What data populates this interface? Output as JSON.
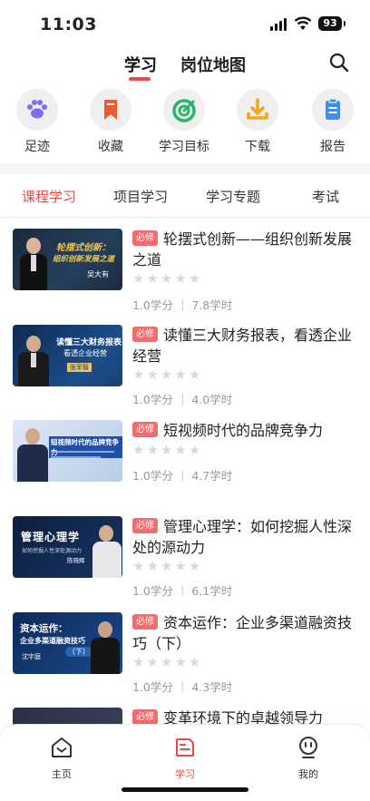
{
  "status": {
    "time": "11:03",
    "battery": "93"
  },
  "header": {
    "tabs": [
      {
        "label": "学习"
      },
      {
        "label": "岗位地图"
      }
    ],
    "active_tab": 0
  },
  "quick_actions": [
    {
      "label": "足迹",
      "icon": "paw-icon"
    },
    {
      "label": "收藏",
      "icon": "bookmark-icon"
    },
    {
      "label": "学习目标",
      "icon": "target-icon"
    },
    {
      "label": "下载",
      "icon": "download-icon"
    },
    {
      "label": "报告",
      "icon": "clipboard-icon"
    }
  ],
  "sub_tabs": [
    {
      "label": "课程学习"
    },
    {
      "label": "项目学习"
    },
    {
      "label": "学习专题"
    },
    {
      "label": "考试"
    }
  ],
  "courses": [
    {
      "badge": "必修",
      "title": "轮摆式创新——组织创新发展之道",
      "stars": "★★★★★",
      "meta": "1.0学分 ｜ 7.8学时",
      "thumb_title": "轮摆式创新：",
      "thumb_sub": "组织创新发展之道",
      "thumb_name": "吴大有"
    },
    {
      "badge": "必修",
      "title": "读懂三大财务报表，看透企业经营",
      "stars": "★★★★★",
      "meta": "1.0学分 ｜ 4.0学时",
      "thumb_title": "读懂三大财务报表",
      "thumb_sub": "看透企业经营",
      "thumb_name": "张军智"
    },
    {
      "badge": "必修",
      "title": "短视频时代的品牌竞争力",
      "stars": "★★★★★",
      "meta": "1.0学分 ｜ 4.7学时",
      "thumb_title": "短视频时代的品牌竞争力",
      "thumb_sub": "",
      "thumb_name": ""
    },
    {
      "badge": "必修",
      "title": "管理心理学：如何挖掘人性深处的源动力",
      "stars": "★★★★★",
      "meta": "1.0学分 ｜ 6.1学时",
      "thumb_title": "管理心理学",
      "thumb_sub": "如何挖掘人性深处源动力",
      "thumb_name": "陈晓辉"
    },
    {
      "badge": "必修",
      "title": "资本运作：企业多渠道融资技巧（下）",
      "stars": "★★★★★",
      "meta": "1.0学分 ｜ 4.3学时",
      "thumb_title": "资本运作：",
      "thumb_sub": "企业多渠道融资技巧",
      "thumb_tag": "（下）",
      "thumb_name": "沈宇庭"
    },
    {
      "badge": "必修",
      "title": "变革环境下的卓越领导力",
      "stars": "",
      "meta": ""
    }
  ],
  "bottom_nav": [
    {
      "label": "主页",
      "icon": "home-icon"
    },
    {
      "label": "学习",
      "icon": "book-icon"
    },
    {
      "label": "我的",
      "icon": "profile-icon"
    }
  ],
  "colors": {
    "accent": "#e84b46",
    "badge": "#f26d6d"
  }
}
